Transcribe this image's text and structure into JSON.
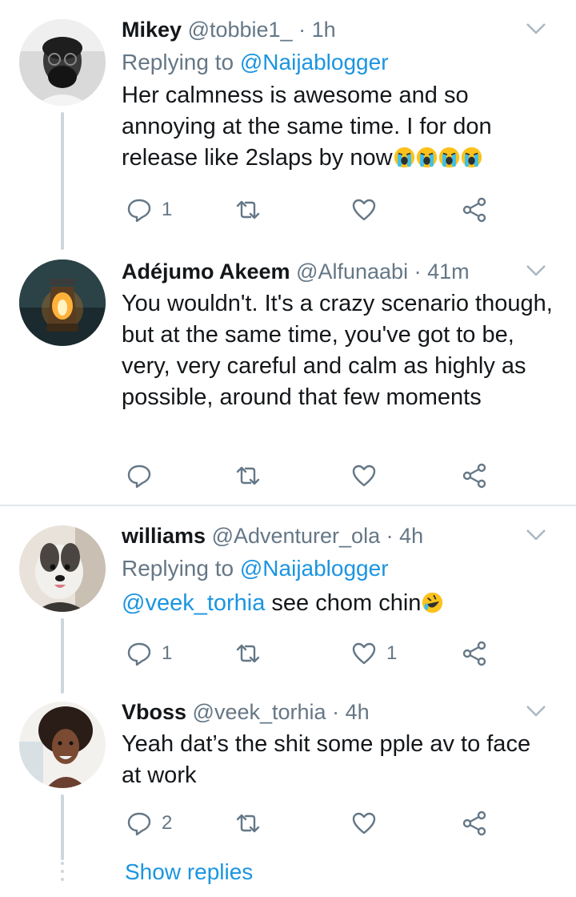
{
  "tweets": [
    {
      "name": "Mikey",
      "handle": "@tobbie1_",
      "separator": "·",
      "time": "1h",
      "replying_prefix": "Replying to ",
      "replying_handle": "@Naijablogger",
      "text": "Her calmness is awesome and so annoying at the same time. I for don release like 2slaps by now",
      "emojis": [
        "loudly-crying-face",
        "loudly-crying-face",
        "loudly-crying-face",
        "loudly-crying-face"
      ],
      "reply_count": "1",
      "retweet_count": "",
      "like_count": ""
    },
    {
      "name": "Adéjumo Akeem",
      "handle": "@Alfunaabi",
      "separator": "·",
      "time": "41m",
      "text": "You wouldn't. It's a crazy scenario though, but at the same time, you've got to be, very, very careful and calm as highly as possible, around that few moments",
      "reply_count": "",
      "retweet_count": "",
      "like_count": ""
    },
    {
      "name": "williams",
      "handle": "@Adventurer_ola",
      "separator": "·",
      "time": "4h",
      "replying_prefix": "Replying to ",
      "replying_handle": "@Naijablogger",
      "mention": "@veek_torhia",
      "text": " see chom chin",
      "emojis": [
        "rolling-on-floor-laughing"
      ],
      "reply_count": "1",
      "retweet_count": "",
      "like_count": "1"
    },
    {
      "name": "Vboss",
      "handle": "@veek_torhia",
      "separator": "·",
      "time": "4h",
      "text": "Yeah dat’s the shit some pple av to face at work",
      "reply_count": "2",
      "retweet_count": "",
      "like_count": ""
    }
  ],
  "show_replies": "Show replies",
  "colors": {
    "link": "#1b95e0",
    "secondary_text": "#657786",
    "primary_text": "#14171a",
    "thread_line": "#ccd6dd",
    "divider": "#e1e8ed"
  },
  "icons": [
    "reply-icon",
    "retweet-icon",
    "like-icon",
    "share-icon",
    "chevron-down-icon"
  ]
}
